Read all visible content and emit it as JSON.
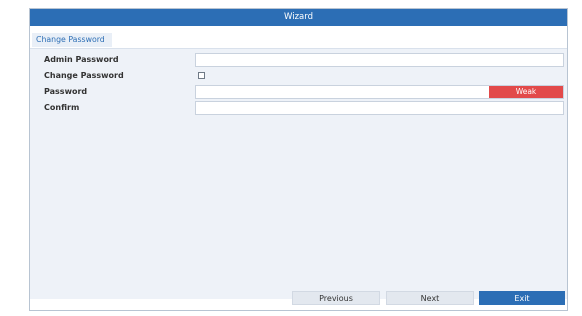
{
  "window": {
    "title": "Wizard"
  },
  "tabs": [
    {
      "label": "Change Password",
      "active": true
    }
  ],
  "form": {
    "rows": [
      {
        "label": "Admin Password",
        "value": ""
      },
      {
        "label": "Change Password",
        "checked": false
      },
      {
        "label": "Password",
        "value": "",
        "strength": "Weak",
        "strength_color": "#e24a4a"
      },
      {
        "label": "Confirm",
        "value": ""
      }
    ]
  },
  "footer": {
    "previous_label": "Previous",
    "next_label": "Next",
    "exit_label": "Exit"
  },
  "colors": {
    "accent": "#2c6eb5",
    "background": "#eef2f8",
    "weak": "#e24a4a"
  }
}
